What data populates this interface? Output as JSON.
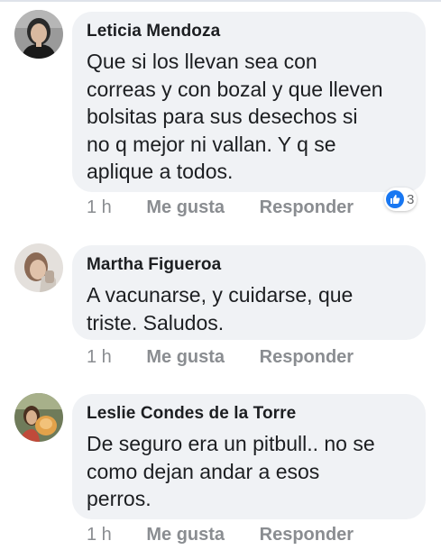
{
  "comments": [
    {
      "author": "Leticia Mendoza",
      "text": "Que si los llevan sea con\ncorreas y con bozal y que lleven\nbolsitas para sus desechos si\nno q mejor ni vallan. Y q se\naplique a todos.",
      "time": "1 h",
      "like_label": "Me gusta",
      "reply_label": "Responder",
      "reaction_icon": "like-icon",
      "reaction_count": "3"
    },
    {
      "author": "Martha Figueroa",
      "text": "A vacunarse, y cuidarse, que\ntriste. Saludos.",
      "time": "1 h",
      "like_label": "Me gusta",
      "reply_label": "Responder"
    },
    {
      "author": "Leslie Condes de la Torre",
      "text": "De seguro era un pitbull.. no se\ncomo dejan andar a esos\nperros.",
      "time": "1 h",
      "like_label": "Me gusta",
      "reply_label": "Responder"
    }
  ],
  "colors": {
    "bubble": "#f0f2f5",
    "text": "#1c1e21",
    "meta": "#8a8d91",
    "like_blue": "#1877f2"
  }
}
